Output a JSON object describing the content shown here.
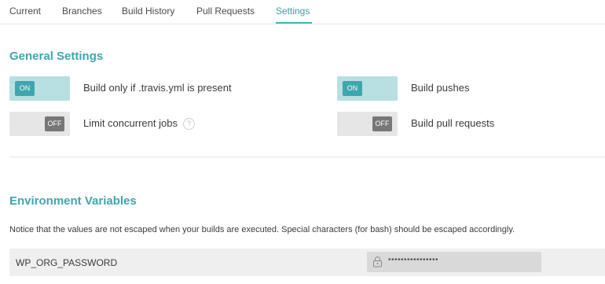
{
  "tabs": [
    {
      "label": "Current",
      "active": false
    },
    {
      "label": "Branches",
      "active": false
    },
    {
      "label": "Build History",
      "active": false
    },
    {
      "label": "Pull Requests",
      "active": false
    },
    {
      "label": "Settings",
      "active": true
    }
  ],
  "general_settings": {
    "title": "General Settings",
    "settings": [
      {
        "label": "Build only if .travis.yml is present",
        "toggle_text": "ON",
        "enabled": true
      },
      {
        "label": "Build pushes",
        "toggle_text": "ON",
        "enabled": true
      },
      {
        "label": "Limit concurrent jobs",
        "toggle_text": "OFF",
        "enabled": false,
        "help_icon": "?"
      },
      {
        "label": "Build pull requests",
        "toggle_text": "OFF",
        "enabled": false
      }
    ]
  },
  "environment_variables": {
    "title": "Environment Variables",
    "notice": "Notice that the values are not escaped when your builds are executed. Special characters (for bash) should be escaped accordingly.",
    "variables": [
      {
        "name": "WP_ORG_PASSWORD",
        "value_masked": "••••••••••••••••",
        "icon": "lock-icon"
      }
    ]
  },
  "colors": {
    "accent": "#3ea6ad",
    "toggle_on_track": "#b8dfe2",
    "toggle_off_knob": "#777777",
    "row_background": "#efefef"
  }
}
